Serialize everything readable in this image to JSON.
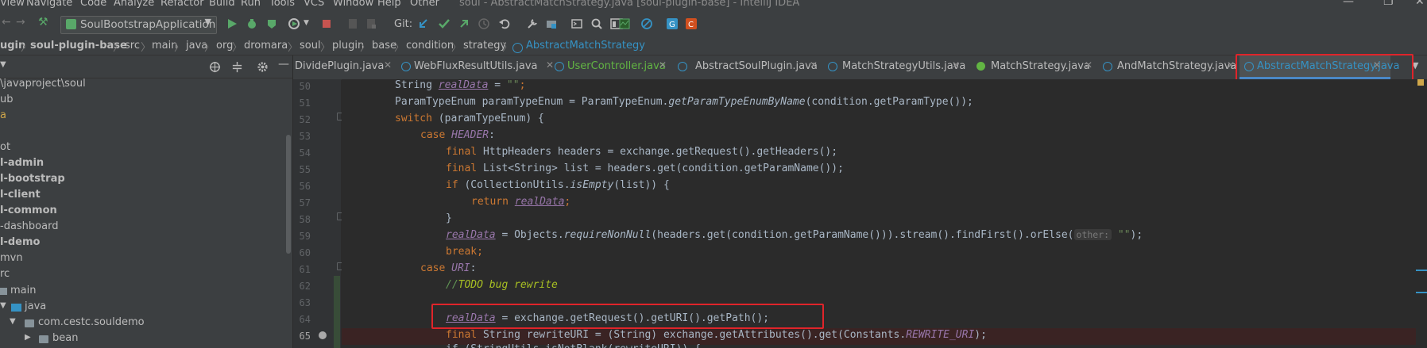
{
  "menu": {
    "items": [
      "View",
      "Navigate",
      "Code",
      "Analyze",
      "Refactor",
      "Build",
      "Run",
      "Tools",
      "VCS",
      "Window",
      "Help",
      "Other"
    ],
    "window_title": "soul - AbstractMatchStrategy.java [soul-plugin-base] - IntelliJ IDEA"
  },
  "toolbar": {
    "run_config": "SoulBootstrapApplication",
    "git_label": "Git:"
  },
  "breadcrumb": [
    "ugin",
    "soul-plugin-base",
    "src",
    "main",
    "java",
    "org",
    "dromara",
    "soul",
    "plugin",
    "base",
    "condition",
    "strategy",
    "AbstractMatchStrategy"
  ],
  "project_tree": [
    {
      "label": "\\javaproject\\soul",
      "bold": false
    },
    {
      "label": "ub",
      "bold": false
    },
    {
      "label": "a",
      "bold": false
    },
    {
      "label": "",
      "bold": false
    },
    {
      "label": "ot",
      "bold": false
    },
    {
      "label": "l-admin",
      "bold": true
    },
    {
      "label": "l-bootstrap",
      "bold": true
    },
    {
      "label": "l-client",
      "bold": true
    },
    {
      "label": "l-common",
      "bold": true
    },
    {
      "label": "-dashboard",
      "bold": false
    },
    {
      "label": "l-demo",
      "bold": true
    },
    {
      "label": "mvn",
      "bold": false
    },
    {
      "label": "rc",
      "bold": false
    },
    {
      "label": "main",
      "bold": false
    },
    {
      "label": "java",
      "bold": false
    },
    {
      "label": "com.cestc.souldemo",
      "bold": false
    },
    {
      "label": "bean",
      "bold": false
    }
  ],
  "tabs": [
    {
      "label": "DividePlugin.java",
      "color": "#3592c4",
      "active": false,
      "green": false
    },
    {
      "label": "WebFluxResultUtils.java",
      "color": "#3592c4",
      "active": false,
      "green": false
    },
    {
      "label": "UserController.java",
      "color": "#3592c4",
      "active": false,
      "green": true
    },
    {
      "label": "AbstractSoulPlugin.java",
      "color": "#3592c4",
      "active": false,
      "green": false
    },
    {
      "label": "MatchStrategyUtils.java",
      "color": "#3592c4",
      "active": false,
      "green": false
    },
    {
      "label": "MatchStrategy.java",
      "color": "#62b543",
      "active": false,
      "green": false
    },
    {
      "label": "AndMatchStrategy.java",
      "color": "#3592c4",
      "active": false,
      "green": false
    },
    {
      "label": "AbstractMatchStrategy.java",
      "color": "#3592c4",
      "active": true,
      "green": false
    }
  ],
  "line_numbers": [
    "50",
    "51",
    "52",
    "53",
    "54",
    "55",
    "56",
    "57",
    "58",
    "59",
    "60",
    "61",
    "62",
    "63",
    "64",
    "65"
  ],
  "code": {
    "l50_a": "String ",
    "l50_b": "realData",
    "l50_c": " = ",
    "l50_d": "\"\"",
    "l50_e": ";",
    "l51_a": "ParamTypeEnum paramTypeEnum = ParamTypeEnum.",
    "l51_b": "getParamTypeEnumByName",
    "l51_c": "(condition.getParamType());",
    "l52_a": "switch",
    "l52_b": " (paramTypeEnum) {",
    "l53_a": "case ",
    "l53_b": "HEADER",
    "l53_c": ":",
    "l54_a": "final ",
    "l54_b": "HttpHeaders headers = exchange.getRequest().getHeaders();",
    "l55_a": "final ",
    "l55_b": "List<String> list = headers.get(condition.getParamName());",
    "l56_a": "if",
    "l56_b": " (CollectionUtils.",
    "l56_c": "isEmpty",
    "l56_d": "(list)) {",
    "l57_a": "return ",
    "l57_b": "realData",
    "l57_c": ";",
    "l58": "}",
    "l59_a": "realData",
    "l59_b": " = Objects.",
    "l59_c": "requireNonNull",
    "l59_d": "(headers.get(condition.getParamName())).stream().findFirst().orElse(",
    "l59_hint": "other:",
    "l59_e": " \"\"",
    "l59_f": ");",
    "l60": "break;",
    "l61_a": "case ",
    "l61_b": "URI",
    "l61_c": ":",
    "l62_a": "//",
    "l62_b": "TODO bug rewrite",
    "l64_a": "realData",
    "l64_b": " = exchange.getRequest().getURI().getPath();",
    "l65_a": "final ",
    "l65_b": "String rewriteURI = (String) exchange.getAttributes().get(Constants.",
    "l65_c": "REWRITE_URI",
    "l65_d": ");",
    "l66": "if (StringUtils.isNotBlank(rewriteURI)) {"
  }
}
